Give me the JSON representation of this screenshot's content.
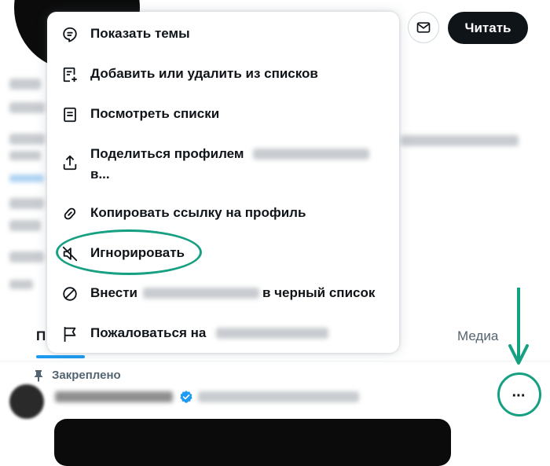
{
  "header": {
    "follow_label": "Читать",
    "mail_icon": "mail-icon"
  },
  "menu": {
    "items": [
      {
        "label": "Показать темы",
        "icon": "topics-icon"
      },
      {
        "label": "Добавить или удалить из списков",
        "icon": "list-add-icon"
      },
      {
        "label": "Посмотреть списки",
        "icon": "list-icon"
      },
      {
        "label_line1": "Поделиться профилем",
        "label_line2": "в...",
        "icon": "share-icon"
      },
      {
        "label": "Копировать ссылку на профиль",
        "icon": "link-icon"
      },
      {
        "label": "Игнорировать",
        "icon": "mute-icon"
      },
      {
        "label_before": "Внести",
        "label_after": "в черный список",
        "icon": "block-icon"
      },
      {
        "label": "Пожаловаться на",
        "icon": "flag-icon"
      }
    ]
  },
  "tabs": {
    "first_label": "П",
    "media_label": "Медиа"
  },
  "pinned": {
    "label": "Закреплено"
  },
  "more_button": {
    "label": "···"
  },
  "colors": {
    "accent": "#1d9bf0",
    "annotation": "#16a082",
    "text": "#0f1419",
    "secondary": "#536471"
  }
}
